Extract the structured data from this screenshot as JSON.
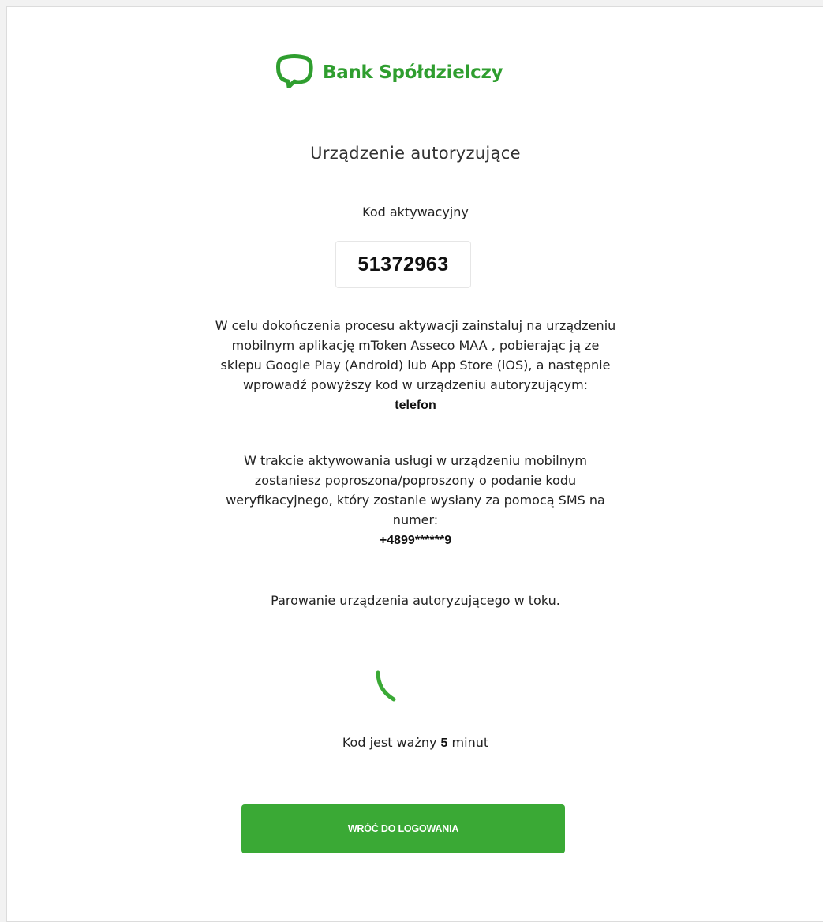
{
  "brand": {
    "name": "Bank Spółdzielczy",
    "color": "#2f9e2f",
    "logo_icon": "speech-bubble-logo-icon"
  },
  "page": {
    "title": "Urządzenie autoryzujące"
  },
  "activation": {
    "label": "Kod aktywacyjny",
    "code": "51372963"
  },
  "instructions": {
    "line1": "W celu dokończenia procesu aktywacji zainstaluj na urządzeniu",
    "line2": "mobilnym aplikację mToken Asseco MAA , pobierając ją ze",
    "line3": "sklepu Google Play (Android) lub App Store (iOS), a następnie",
    "line4": "wprowadź powyższy kod w urządzeniu autoryzującym:",
    "device": "telefon"
  },
  "verification": {
    "line1": "W trakcie aktywowania usługi w urządzeniu mobilnym",
    "line2": "zostaniesz poproszona/poproszony o podanie kodu",
    "line3": "weryfikacyjnego, który zostanie wysłany za pomocą SMS na",
    "line4": "numer:",
    "phone": "+4899******9"
  },
  "status": {
    "text": "Parowanie urządzenia autoryzującego w toku.",
    "spinner_icon": "loading-spinner-icon"
  },
  "validity": {
    "prefix": "Kod jest ważny",
    "minutes": "5",
    "suffix": "minut"
  },
  "actions": {
    "back_label": "WRÓĆ DO LOGOWANIA",
    "button_color": "#3aa935"
  }
}
